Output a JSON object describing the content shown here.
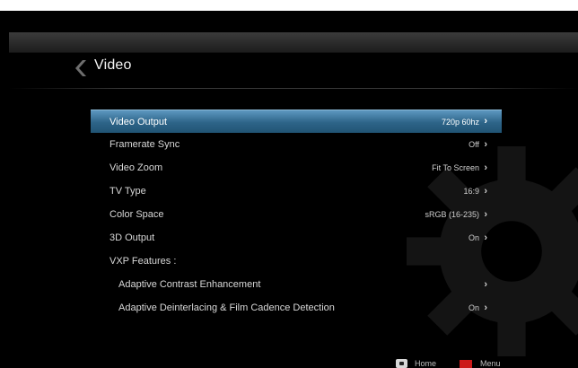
{
  "header": {
    "title": "Video",
    "back_icon": "chevron-left-icon"
  },
  "menu": {
    "items": [
      {
        "label": "Video Output",
        "value": "720p 60hz",
        "arrow": "›",
        "selected": true
      },
      {
        "label": "Framerate Sync",
        "value": "Off",
        "arrow": "›"
      },
      {
        "label": "Video Zoom",
        "value": "Fit To Screen",
        "arrow": "›"
      },
      {
        "label": "TV Type",
        "value": "16:9",
        "arrow": "›"
      },
      {
        "label": "Color Space",
        "value": "sRGB (16-235)",
        "arrow": "›"
      },
      {
        "label": "3D Output",
        "value": "On",
        "arrow": "›"
      },
      {
        "label": "VXP Features :"
      },
      {
        "label": "Adaptive Contrast Enhancement",
        "value": "",
        "arrow": "›"
      },
      {
        "label": "Adaptive Deinterlacing & Film Cadence Detection",
        "value": "On",
        "arrow": "›"
      }
    ]
  },
  "footer": {
    "home_label": "Home",
    "menu_label": "Menu",
    "menu_button_color": "#cc1a1a"
  },
  "colors": {
    "selected_row": "#2d6488",
    "background": "#000000"
  }
}
